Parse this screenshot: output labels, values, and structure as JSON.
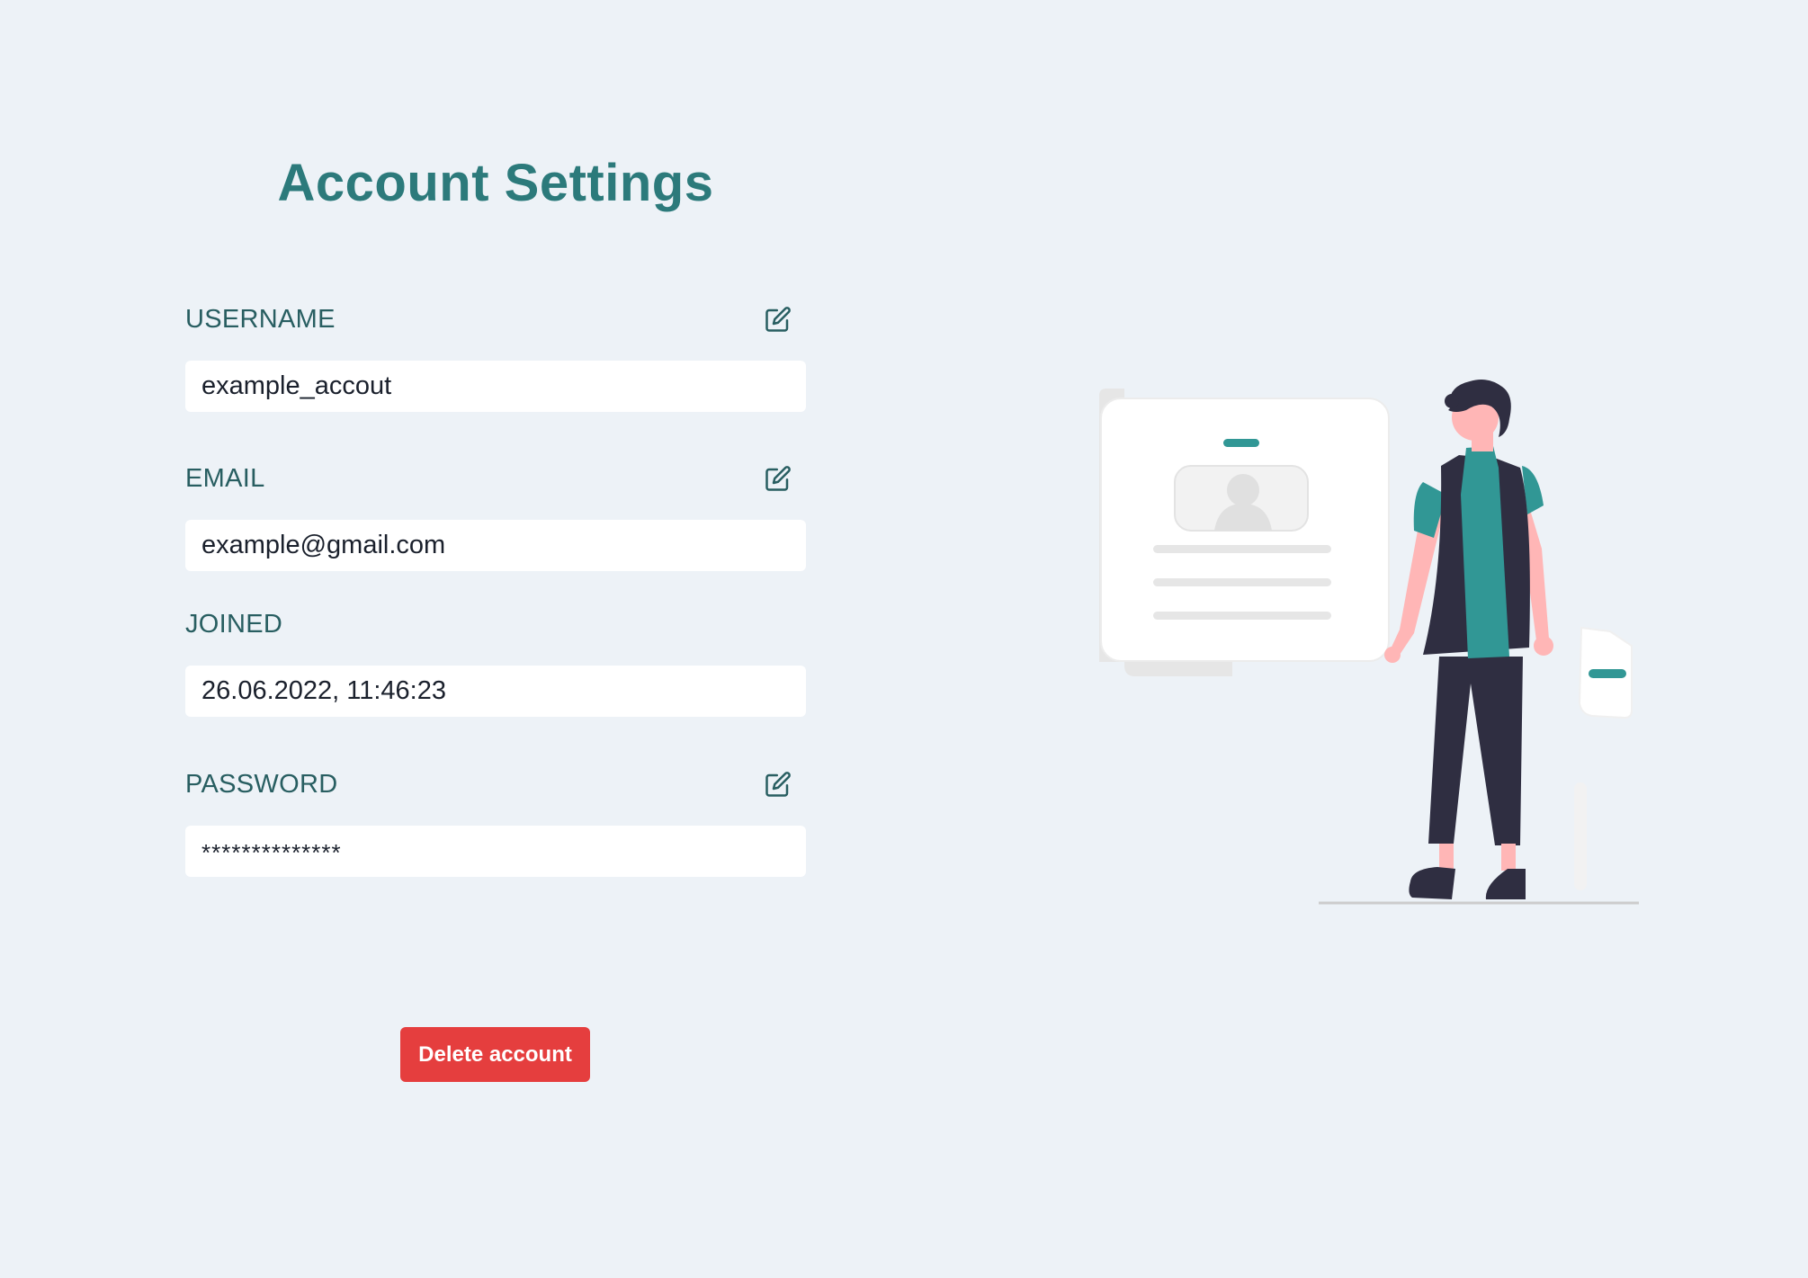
{
  "page": {
    "title": "Account Settings"
  },
  "fields": {
    "username": {
      "label": "USERNAME",
      "value": "example_accout",
      "editable": true,
      "edit_icon": "edit-icon"
    },
    "email": {
      "label": "EMAIL",
      "value": "example@gmail.com",
      "editable": true,
      "edit_icon": "edit-icon"
    },
    "joined": {
      "label": "JOINED",
      "value": "26.06.2022, 11:46:23",
      "editable": false
    },
    "password": {
      "label": "PASSWORD",
      "value": "**************",
      "editable": true,
      "edit_icon": "edit-icon"
    }
  },
  "actions": {
    "delete_label": "Delete account"
  },
  "illustration": {
    "name": "profile-card-illustration"
  },
  "colors": {
    "background": "#edf2f7",
    "title": "#2c7a7b",
    "label": "#285e61",
    "input_bg": "#ffffff",
    "danger": "#e53e3e",
    "accent": "#319795"
  }
}
